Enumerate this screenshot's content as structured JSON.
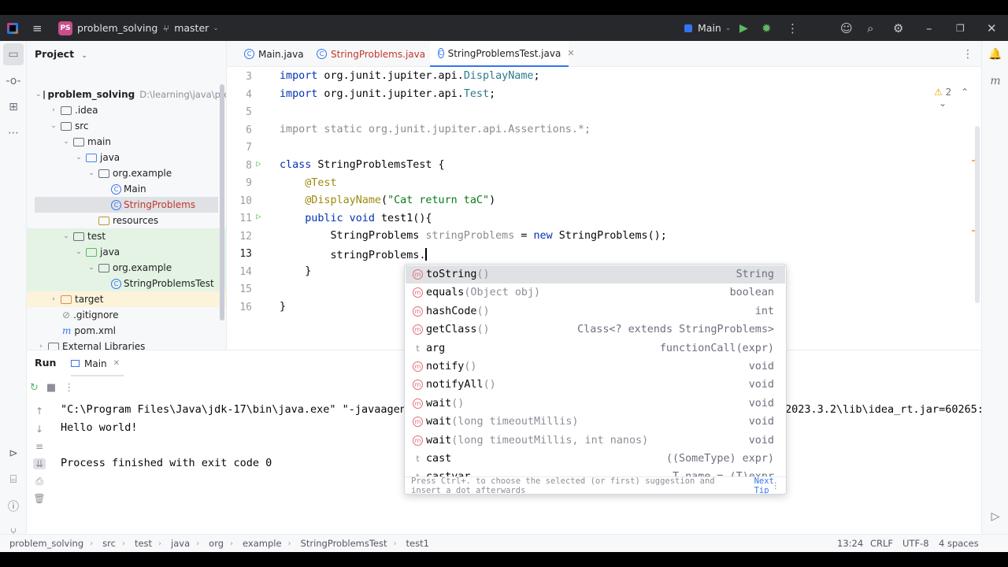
{
  "titlebar": {
    "project_badge": "PS",
    "project_name": "problem_solving",
    "branch": "master",
    "run_config": "Main"
  },
  "project_panel": {
    "title": "Project",
    "tree": [
      {
        "label": "problem_solving",
        "path": "D:\\learning\\java\\progi"
      },
      {
        "label": ".idea"
      },
      {
        "label": "src"
      },
      {
        "label": "main"
      },
      {
        "label": "java"
      },
      {
        "label": "org.example"
      },
      {
        "label": "Main"
      },
      {
        "label": "StringProblems"
      },
      {
        "label": "resources"
      },
      {
        "label": "test"
      },
      {
        "label": "java"
      },
      {
        "label": "org.example"
      },
      {
        "label": "StringProblemsTest"
      },
      {
        "label": "target"
      },
      {
        "label": ".gitignore"
      },
      {
        "label": "pom.xml"
      },
      {
        "label": "External Libraries"
      }
    ]
  },
  "editor": {
    "tabs": [
      {
        "label": "Main.java"
      },
      {
        "label": "StringProblems.java"
      },
      {
        "label": "StringProblemsTest.java"
      }
    ],
    "warnings_count": "2",
    "line_numbers": [
      "3",
      "4",
      "5",
      "6",
      "7",
      "8",
      "9",
      "10",
      "11",
      "12",
      "13",
      "14",
      "15",
      "16"
    ]
  },
  "completion": {
    "items": [
      {
        "name": "toString",
        "sig": "()",
        "type": "String",
        "icon": "m"
      },
      {
        "name": "equals",
        "sig": "(Object obj)",
        "type": "boolean",
        "icon": "m"
      },
      {
        "name": "hashCode",
        "sig": "()",
        "type": "int",
        "icon": "m"
      },
      {
        "name": "getClass",
        "sig": "()",
        "type": "Class<? extends StringProblems>",
        "icon": "m"
      },
      {
        "name": "arg",
        "sig": "",
        "type": "functionCall(expr)",
        "icon": "t"
      },
      {
        "name": "notify",
        "sig": "()",
        "type": "void",
        "icon": "m"
      },
      {
        "name": "notifyAll",
        "sig": "()",
        "type": "void",
        "icon": "m"
      },
      {
        "name": "wait",
        "sig": "()",
        "type": "void",
        "icon": "m"
      },
      {
        "name": "wait",
        "sig": "(long timeoutMillis)",
        "type": "void",
        "icon": "m"
      },
      {
        "name": "wait",
        "sig": "(long timeoutMillis, int nanos)",
        "type": "void",
        "icon": "m"
      },
      {
        "name": "cast",
        "sig": "",
        "type": "((SomeType) expr)",
        "icon": "t"
      },
      {
        "name": "castvar",
        "sig": "",
        "type": "T name = (T)expr",
        "icon": "t"
      }
    ],
    "footer": "Press Ctrl+. to choose the selected (or first) suggestion and insert a dot afterwards",
    "next_tip": "Next Tip"
  },
  "run_panel": {
    "title": "Run",
    "tab": "Main",
    "cmd_line": "\"C:\\Program Files\\Java\\jdk-17\\bin\\java.exe\" \"-javaagen",
    "cmd_tail": "2023.3.2\\lib\\idea_rt.jar=60265:",
    "output": "Hello world!",
    "exit": "Process finished with exit code 0"
  },
  "statusbar": {
    "crumbs": [
      "problem_solving",
      "src",
      "test",
      "java",
      "org",
      "example",
      "StringProblemsTest",
      "test1"
    ],
    "position": "13:24",
    "line_sep": "CRLF",
    "encoding": "UTF-8",
    "indent": "4 spaces"
  }
}
